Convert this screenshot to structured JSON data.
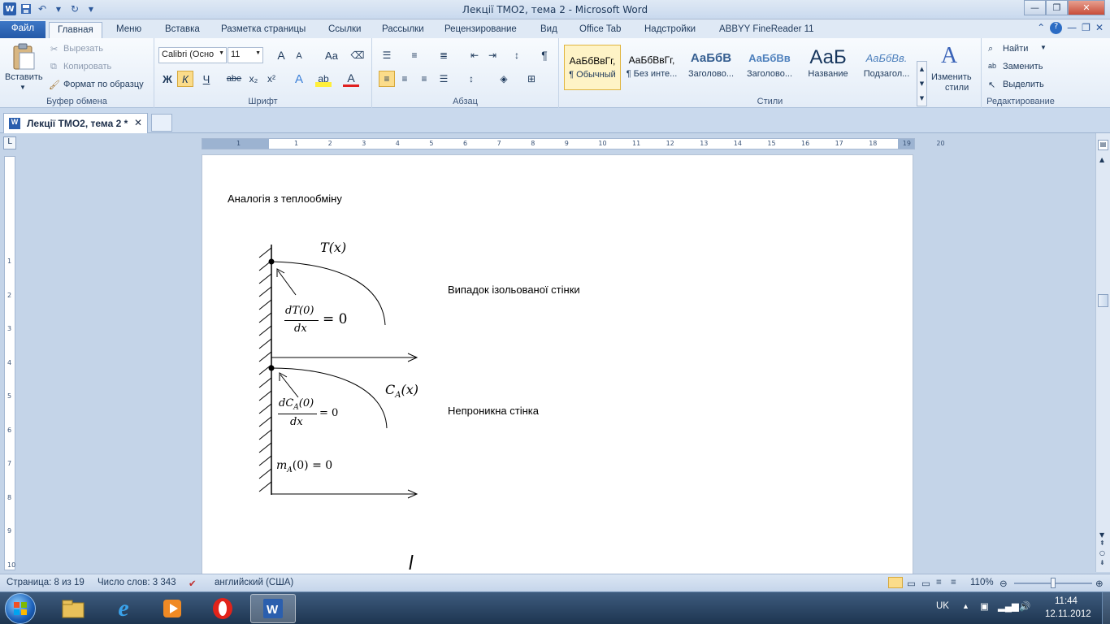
{
  "window": {
    "title": "Лекції ТМО2, тема 2  -  Microsoft Word"
  },
  "tabs": {
    "file": "Файл",
    "items": [
      "Главная",
      "Меню",
      "Вставка",
      "Разметка страницы",
      "Ссылки",
      "Рассылки",
      "Рецензирование",
      "Вид",
      "Office Tab",
      "Надстройки",
      "ABBYY FineReader 11"
    ]
  },
  "ribbon": {
    "clipboard": {
      "label": "Буфер обмена",
      "paste": "Вставить",
      "cut": "Вырезать",
      "copy": "Копировать",
      "format_painter": "Формат по образцу"
    },
    "font": {
      "label": "Шрифт",
      "family": "Calibri (Осно",
      "size": "11",
      "bold": "Ж",
      "italic": "К",
      "underline": "Ч",
      "strike": "abe",
      "grow": "A",
      "shrink": "A",
      "case": "Aa"
    },
    "paragraph": {
      "label": "Абзац"
    },
    "styles": {
      "label": "Стили",
      "items": [
        {
          "sample": "АаБбВвГг,",
          "name": "¶ Обычный"
        },
        {
          "sample": "АаБбВвГг,",
          "name": "¶ Без инте..."
        },
        {
          "sample": "АаБбВ",
          "name": "Заголово..."
        },
        {
          "sample": "АаБбВв",
          "name": "Заголово..."
        },
        {
          "sample": "АаБ",
          "name": "Название"
        },
        {
          "sample": "АаБбВв.",
          "name": "Подзагол..."
        }
      ],
      "change": "Изменить",
      "change2": "стили"
    },
    "editing": {
      "label": "Редактирование",
      "find": "Найти",
      "replace": "Заменить",
      "select": "Выделить"
    }
  },
  "doctab": {
    "title": "Лекції ТМО2, тема 2 *"
  },
  "document": {
    "heading": "Аналогія з теплообміну",
    "label1": "Випадок ізольованої стінки",
    "label2": "Непроникна  стінка",
    "math": {
      "tx": "T(x)",
      "dT_num": "dT(0)",
      "dT_den": "dx",
      "dT_eq": "= 0",
      "ca": "C",
      "ca_sub": "A",
      "ca_arg": "(x)",
      "dC_num": "dC",
      "dC_sub": "A",
      "dC_arg": "(0)",
      "dC_den": "dx",
      "dC_eq": "= 0",
      "m": "m",
      "m_sub": "A",
      "m_eq": "(0) = 0"
    }
  },
  "ruler": {
    "numbers": [
      "1",
      "1",
      "2",
      "3",
      "4",
      "5",
      "6",
      "7",
      "8",
      "9",
      "10",
      "11",
      "12",
      "13",
      "14",
      "15",
      "16",
      "17",
      "18",
      "19",
      "20"
    ],
    "vnumbers": [
      "1",
      "2",
      "3",
      "4",
      "5",
      "6",
      "7",
      "8",
      "9",
      "10",
      "11"
    ]
  },
  "status": {
    "page": "Страница: 8 из 19",
    "words": "Число слов: 3 343",
    "lang": "английский (США)",
    "zoom": "110%"
  },
  "tray": {
    "lang": "UK",
    "time": "11:44",
    "date": "12.11.2012"
  }
}
